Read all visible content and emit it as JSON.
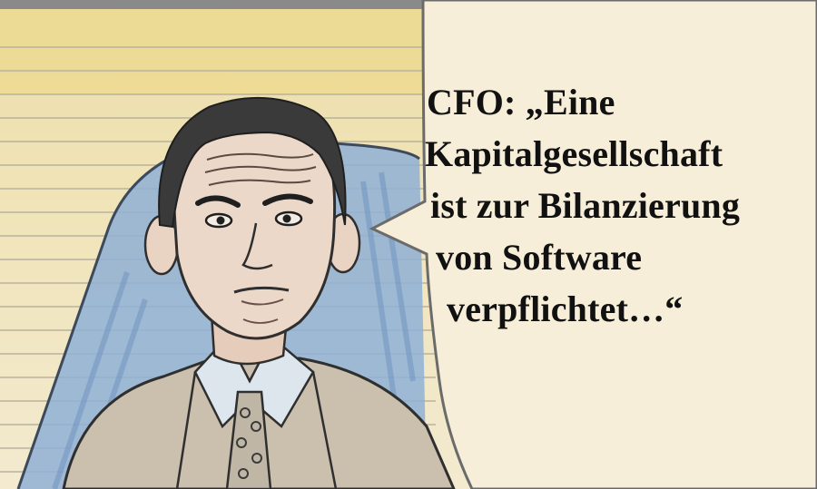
{
  "speech_bubble": {
    "lines": [
      "CFO: „Eine",
      "Kapitalgesellschaft",
      "ist zur Bilanzierung",
      "von Software",
      "verpflichtet…“"
    ]
  },
  "colors": {
    "paper": "#f1e7c7",
    "ruled_lines": "#c9c2b0",
    "bubble_fill": "#f6eed8",
    "bubble_outline": "#6b6b6b",
    "chair_blue": "#8fb0d6",
    "skin": "#e9d3c3",
    "hair": "#3a3a3a"
  },
  "character": {
    "role": "CFO",
    "icon": "cfo-portrait-sketch"
  }
}
